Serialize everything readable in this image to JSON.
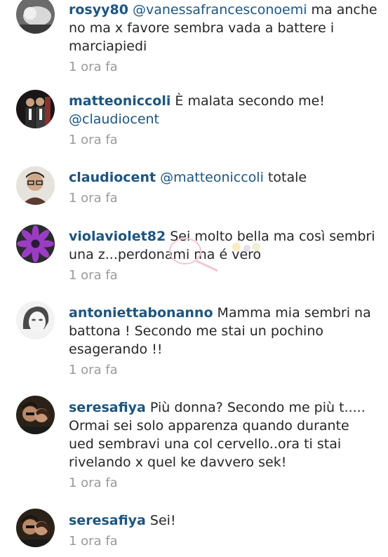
{
  "comments": [
    {
      "avatar_icon": "baby-photo-avatar",
      "username": "rosyy80",
      "mention": "@vanessafrancesconoemi",
      "text": " ma anche no ma x favore sembra vada a battere i marciapiedi",
      "time": "1 ora fa"
    },
    {
      "avatar_icon": "couple-photo-avatar",
      "username": "matteoniccoli",
      "text": " È malata secondo me! ",
      "mention": "@claudiocent",
      "time": "1 ora fa"
    },
    {
      "avatar_icon": "man-glasses-avatar",
      "username": "claudiocent",
      "mention": "@matteoniccoli",
      "text": " totale",
      "time": "1 ora fa"
    },
    {
      "avatar_icon": "purple-flower-avatar",
      "username": "violaviolet82",
      "text": " Sei molto bella ma così sembri una z...perdonami ma é vero",
      "time": "1 ora fa"
    },
    {
      "avatar_icon": "woman-face-avatar",
      "username": "antoniettabonanno",
      "text": " Mamma mia sembri na battona ! Secondo me stai un pochino esagerando !!",
      "time": "1 ora fa"
    },
    {
      "avatar_icon": "couple-dark-avatar",
      "username": "seresafiya",
      "text": " Più donna? Secondo me più t..... Ormai sei solo apparenza quando durante ued sembravi una col cervello..ora ti stai rivelando x quel ke davvero sek!",
      "time": "1 ora fa"
    },
    {
      "avatar_icon": "couple-dark-avatar",
      "username": "seresafiya",
      "text": " Sei!",
      "time": "1 ora fa"
    }
  ]
}
